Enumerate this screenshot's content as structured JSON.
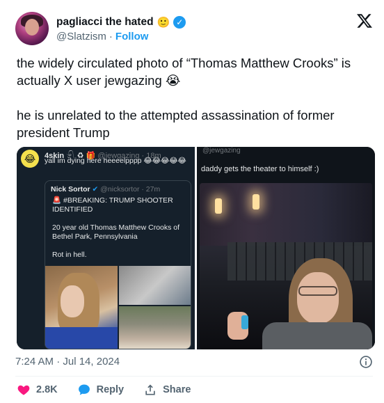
{
  "author": {
    "display_name": "pagliacci the hated",
    "name_emoji": "🙂",
    "handle": "@Slatzism",
    "separator": "·",
    "follow_label": "Follow"
  },
  "tweet": {
    "paragraphs": [
      "the widely circulated photo of “Thomas Matthew Crooks” is actually X user jewgazing 😭",
      "he is unrelated to the attempted assassination of former president Trump"
    ]
  },
  "media": {
    "left": {
      "author": "4skin",
      "author_extra": "𓍯 ♻ 🎁",
      "handle_time": "@jewgazing · 18m",
      "text": "yall im dying here heeeelpppp 😂😂😂😂😂",
      "quote": {
        "author": "Nick Sortor",
        "handle_time": "@nicksortor · 27m",
        "line1": "🚨 #BREAKING: TRUMP SHOOTER IDENTIFIED",
        "line2": "20 year old Thomas Matthew Crooks of Bethel Park, Pennsylvania",
        "line3": "Rot in hell."
      }
    },
    "right": {
      "handle": "@jewgazing",
      "text": "daddy gets the theater to himself :)"
    }
  },
  "timestamp": "7:24 AM · Jul 14, 2024",
  "actions": {
    "likes": "2.8K",
    "reply_label": "Reply",
    "share_label": "Share"
  },
  "colors": {
    "accent": "#1d9bf0",
    "like": "#f91880",
    "secondary_text": "#536471"
  },
  "icons": {
    "brand": "x-logo-icon",
    "verified": "verified-badge-icon",
    "info": "info-icon",
    "like": "heart-icon",
    "reply": "reply-bubble-icon",
    "share": "share-upload-icon"
  }
}
